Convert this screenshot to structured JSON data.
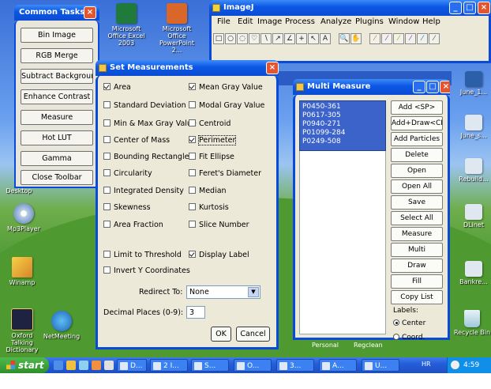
{
  "common_tasks": {
    "title": "Common Tasks",
    "buttons": [
      "Bin Image",
      "RGB Merge",
      "Subtract Background",
      "Enhance Contrast",
      "Measure",
      "Hot LUT",
      "Gamma",
      "Close Toolbar"
    ]
  },
  "desktop": {
    "icons": [
      {
        "label": "Microsoft Office Excel 2003"
      },
      {
        "label": "Microsoft Office PowerPoint 2..."
      },
      {
        "label": "Desktop"
      },
      {
        "label": "Mp3Player"
      },
      {
        "label": "Winamp"
      },
      {
        "label": "Oxford Talking Dictionary"
      },
      {
        "label": "NetMeeting"
      },
      {
        "label": "June_1..."
      },
      {
        "label": "June_s..."
      },
      {
        "label": "Rebuild..."
      },
      {
        "label": "DLinet"
      },
      {
        "label": "Bankre..."
      },
      {
        "label": "Recycle Bin"
      }
    ],
    "bottom_labels": [
      "Personal",
      "Regclean"
    ]
  },
  "imagej": {
    "title": "ImageJ",
    "menu": [
      "File",
      "Edit",
      "Image",
      "Process",
      "Analyze",
      "Plugins",
      "Window",
      "Help"
    ],
    "tools": [
      "□",
      "○",
      "◌",
      "♡",
      "∖",
      "↗",
      "∠",
      "+",
      "↖",
      "A",
      "🔍",
      "✋",
      "⁄",
      "⁄",
      "⁄",
      "⁄",
      "⁄",
      "⁄"
    ]
  },
  "set_measurements": {
    "title": "Set Measurements",
    "col1": [
      {
        "label": "Area",
        "checked": true
      },
      {
        "label": "Standard Deviation",
        "checked": false
      },
      {
        "label": "Min & Max Gray Value",
        "checked": false
      },
      {
        "label": "Center of Mass",
        "checked": false
      },
      {
        "label": "Bounding Rectangle",
        "checked": false
      },
      {
        "label": "Circularity",
        "checked": false
      },
      {
        "label": "Integrated Density",
        "checked": false
      },
      {
        "label": "Skewness",
        "checked": false
      },
      {
        "label": "Area Fraction",
        "checked": false
      }
    ],
    "col2": [
      {
        "label": "Mean Gray Value",
        "checked": true
      },
      {
        "label": "Modal Gray Value",
        "checked": false
      },
      {
        "label": "Centroid",
        "checked": false
      },
      {
        "label": "Perimeter",
        "checked": true
      },
      {
        "label": "Fit Ellipse",
        "checked": false
      },
      {
        "label": "Feret's Diameter",
        "checked": false
      },
      {
        "label": "Median",
        "checked": false
      },
      {
        "label": "Kurtosis",
        "checked": false
      },
      {
        "label": "Slice Number",
        "checked": false
      }
    ],
    "limit_to_threshold": {
      "label": "Limit to Threshold",
      "checked": false
    },
    "display_label": {
      "label": "Display Label",
      "checked": true
    },
    "invert_y": {
      "label": "Invert Y Coordinates",
      "checked": false
    },
    "redirect_label": "Redirect To:",
    "redirect_value": "None",
    "decimal_label": "Decimal Places (0-9):",
    "decimal_value": "3",
    "ok": "OK",
    "cancel": "Cancel"
  },
  "multi_measure": {
    "title": "Multi Measure",
    "list": [
      "P0450-361",
      "P0617-305",
      "P0940-271",
      "P01099-284",
      "P0249-508"
    ],
    "buttons": [
      "Add <SP>",
      "Add+Draw<CR>",
      "Add Particles",
      "Delete",
      "Open",
      "Open All",
      "Save",
      "Select All",
      "Measure",
      "Multi",
      "Draw",
      "Fill",
      "Copy List"
    ],
    "labels_title": "Labels:",
    "radio": [
      {
        "label": "Center",
        "selected": true
      },
      {
        "label": "Coord.",
        "selected": false
      }
    ]
  },
  "taskbar": {
    "start": "start",
    "items": [
      "D...",
      "2 I...",
      "S...",
      "O...",
      "3...",
      "A...",
      "U..."
    ],
    "lang": "HR",
    "clock": "4:59 PM"
  }
}
